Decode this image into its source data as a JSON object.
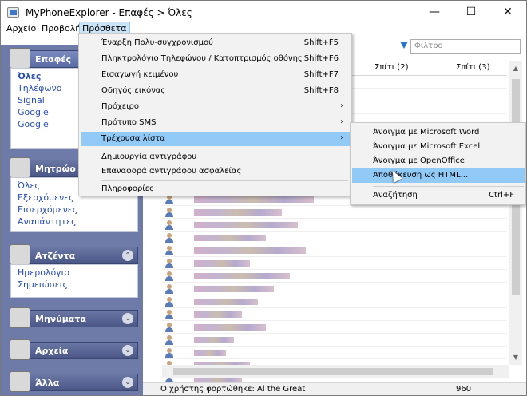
{
  "window": {
    "title": "MyPhoneExplorer - Επαφές > Όλες",
    "minimize": "—",
    "maximize": "☐",
    "close": "✕"
  },
  "menubar": [
    {
      "label": "Αρχείο"
    },
    {
      "label": "Προβολή"
    },
    {
      "label": "Πρόσθετα"
    }
  ],
  "filter": {
    "placeholder": "Φίλτρο"
  },
  "sidebar": {
    "contacts": {
      "title": "Επαφές",
      "items": [
        "Όλες",
        "Τηλέφωνο",
        "Signal",
        "Google",
        "Google"
      ]
    },
    "calls": {
      "title": "Μητρώο κλ",
      "items": [
        "Όλες",
        "Εξερχόμενες",
        "Εισερχόμενες",
        "Αναπάντητες"
      ]
    },
    "agenda": {
      "title": "Ατζέντα",
      "items": [
        "Ημερολόγιο",
        "Σημειώσεις"
      ]
    },
    "messages": {
      "title": "Μηνύματα"
    },
    "files": {
      "title": "Αρχεία"
    },
    "other": {
      "title": "Άλλα"
    }
  },
  "grid": {
    "columns": [
      "Σπίτι (2)",
      "Σπίτι (3)"
    ]
  },
  "menu_tools": [
    {
      "label": "Έναρξη Πολυ-συγχρονισμού",
      "key": "Shift+F5"
    },
    {
      "label": "Πληκτρολόγιο Τηλεφώνου / Κατοπτρισμός οθόνης",
      "key": "Shift+F6"
    },
    {
      "label": "Εισαγωγή κειμένου",
      "key": "Shift+F7"
    },
    {
      "label": "Οδηγός εικόνας",
      "key": "Shift+F8"
    },
    {
      "label": "Πρόχειρο",
      "key": ""
    },
    {
      "label": "Πρότυπο SMS",
      "key": ""
    },
    {
      "label": "Τρέχουσα λίστα",
      "key": ""
    },
    {
      "label": "Δημιουργία αντιγράφου",
      "key": ""
    },
    {
      "label": "Επαναφορά αντιγράφου ασφαλείας",
      "key": ""
    },
    {
      "label": "Πληροφορίες",
      "key": ""
    }
  ],
  "menu_current_list": [
    {
      "label": "Άνοιγμα με Microsoft Word",
      "key": ""
    },
    {
      "label": "Άνοιγμα με Microsoft Excel",
      "key": ""
    },
    {
      "label": "Άνοιγμα με OpenOffice",
      "key": ""
    },
    {
      "label": "Αποθήκευση ως HTML...",
      "key": ""
    },
    {
      "label": "Αναζήτηση",
      "key": "Ctrl+F"
    }
  ],
  "submenu_arrow": "›",
  "collapse_glyph": "⌃",
  "expand_glyph": "⌄",
  "status": {
    "text": "Ο χρήστης φορτώθηκε: Al the Great",
    "count": "960"
  },
  "colors": {
    "menu_highlight": "#91c9f7",
    "sidebar_bg": "#6e7ba8",
    "link": "#2a4fb0"
  }
}
